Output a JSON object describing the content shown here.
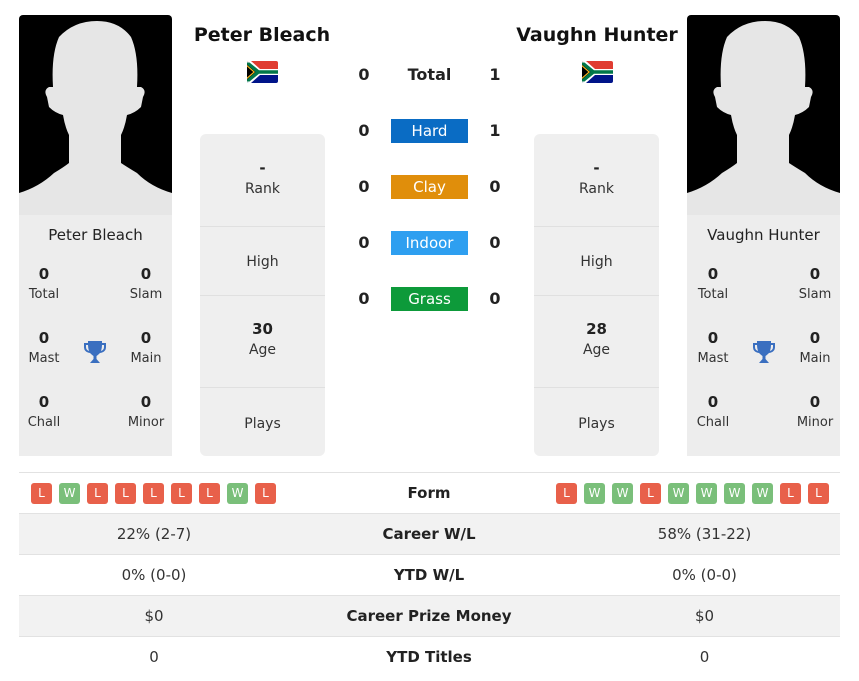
{
  "player1": {
    "name": "Peter Bleach",
    "country": "South Africa",
    "titles": {
      "total": "0",
      "slam": "0",
      "mast": "0",
      "main": "0",
      "chall": "0",
      "minor": "0"
    },
    "rank": "-",
    "high": "",
    "age": "30",
    "plays": "",
    "form": [
      "L",
      "W",
      "L",
      "L",
      "L",
      "L",
      "L",
      "W",
      "L"
    ],
    "career_wl": "22% (2-7)",
    "ytd_wl": "0% (0-0)",
    "prize": "$0",
    "ytd_titles": "0"
  },
  "player2": {
    "name": "Vaughn Hunter",
    "country": "South Africa",
    "titles": {
      "total": "0",
      "slam": "0",
      "mast": "0",
      "main": "0",
      "chall": "0",
      "minor": "0"
    },
    "rank": "-",
    "high": "",
    "age": "28",
    "plays": "",
    "form": [
      "L",
      "W",
      "W",
      "L",
      "W",
      "W",
      "W",
      "W",
      "L",
      "L"
    ],
    "career_wl": "58% (31-22)",
    "ytd_wl": "0% (0-0)",
    "prize": "$0",
    "ytd_titles": "0"
  },
  "labels": {
    "total": "Total",
    "slam": "Slam",
    "mast": "Mast",
    "main": "Main",
    "chall": "Chall",
    "minor": "Minor",
    "rank": "Rank",
    "high": "High",
    "age": "Age",
    "plays": "Plays",
    "form": "Form",
    "career_wl": "Career W/L",
    "ytd_wl": "YTD W/L",
    "prize": "Career Prize Money",
    "ytd_titles": "YTD Titles"
  },
  "h2h": {
    "total": {
      "label": "Total",
      "p1": "0",
      "p2": "1"
    },
    "surfaces": [
      {
        "label": "Hard",
        "p1": "0",
        "p2": "1",
        "color": "#0a6cc4"
      },
      {
        "label": "Clay",
        "p1": "0",
        "p2": "0",
        "color": "#e08e0b"
      },
      {
        "label": "Indoor",
        "p1": "0",
        "p2": "0",
        "color": "#2e9ff0"
      },
      {
        "label": "Grass",
        "p1": "0",
        "p2": "0",
        "color": "#0d9a3a"
      }
    ]
  },
  "colors": {
    "loss": "#e8604a",
    "win": "#7abf7a",
    "trophy": "#3a6fc0"
  }
}
